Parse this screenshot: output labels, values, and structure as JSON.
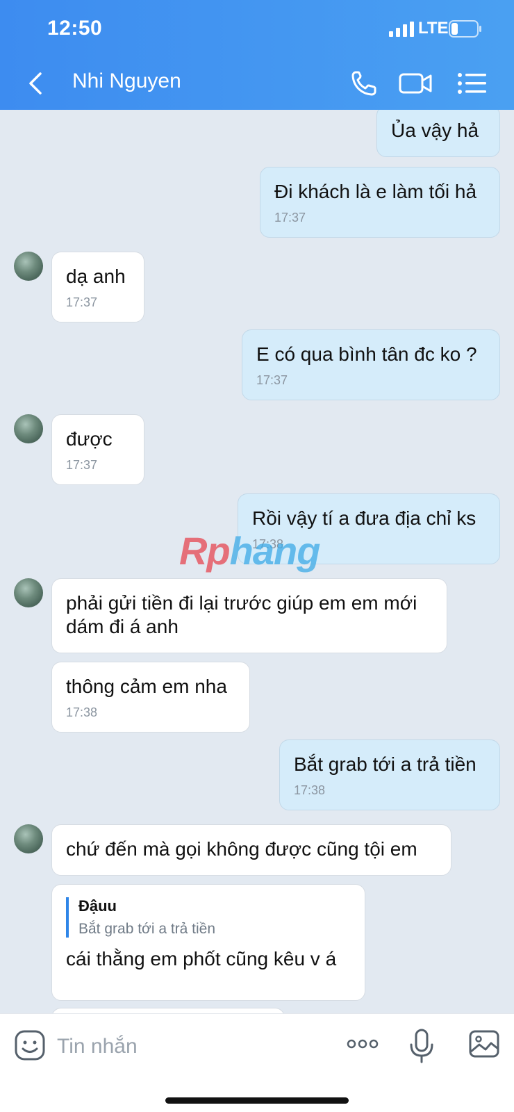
{
  "status_bar": {
    "time": "12:50",
    "network": "LTE"
  },
  "header": {
    "title": "Nhi Nguyen"
  },
  "messages": [
    {
      "text": "Ủa vậy hả"
    },
    {
      "text": "Đi khách là e làm tối hả",
      "time": "17:37"
    },
    {
      "text": "dạ anh",
      "time": "17:37"
    },
    {
      "text": "E có qua bình tân đc ko ?",
      "time": "17:37"
    },
    {
      "text": "được",
      "time": "17:37"
    },
    {
      "text": "Rồi vậy tí a đưa địa chỉ ks",
      "time": "17:38"
    },
    {
      "text": "phải gửi tiền đi lại trước giúp em em mới dám đi á anh"
    },
    {
      "text": "thông cảm em nha",
      "time": "17:38"
    },
    {
      "text": "Bắt grab tới a trả tiền",
      "time": "17:38"
    },
    {
      "text": "chứ đến mà gọi không được cũng tội em"
    },
    {
      "quote_author": "Đậuu",
      "quote_text": "Bắt grab tới a trả tiền",
      "text": "cái thằng em phốt cũng kêu v á"
    }
  ],
  "watermark": {
    "part1": "Rp",
    "part2": "hang"
  },
  "input": {
    "placeholder": "Tin nhắn"
  },
  "colors": {
    "header": "#3d8cf0",
    "sent_bubble": "#d5ecfa",
    "received_bubble": "#ffffff",
    "background": "#e2e9f1"
  }
}
